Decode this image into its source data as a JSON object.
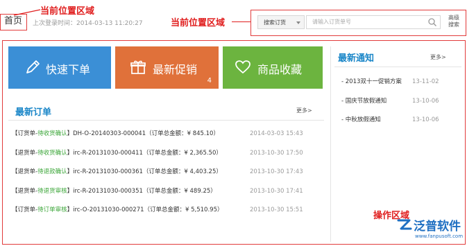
{
  "header": {
    "home_label": "首页",
    "last_login": "上次登录时间：2014-03-13 11:20:27",
    "annotation_left": "当前位置区域",
    "annotation_right": "当前位置区域",
    "search": {
      "category_selected": "搜索订货",
      "placeholder": "请输入订货单号"
    },
    "advanced_search_label": "高级搜索"
  },
  "tiles": [
    {
      "label": "快速下单",
      "icon": "pencil-icon",
      "color": "#3b8fd6"
    },
    {
      "label": "最新促销",
      "icon": "gift-icon",
      "badge": "4",
      "color": "#e0713a"
    },
    {
      "label": "商品收藏",
      "icon": "heart-icon",
      "color": "#6cb43f"
    }
  ],
  "orders": {
    "title": "最新订单",
    "more": "更多>",
    "rows": [
      {
        "type": "【订货单-",
        "status": "待收货确认",
        "rest": "】DH-O-20140303-000041（订单总金额：¥ 845.10）",
        "time": "2014-03-03 15:43"
      },
      {
        "type": "【退货单-",
        "status": "待收货确认",
        "rest": "】irc-R-20131030-000411（订单总金额：¥ 2,365.50）",
        "time": "2013-10-30 17:50"
      },
      {
        "type": "【退货单-",
        "status": "待退款确认",
        "rest": "】irc-R-20131030-000361（订单总金额：¥ 4,403.25）",
        "time": "2013-10-30 17:43"
      },
      {
        "type": "【退货单-",
        "status": "待退货审核",
        "rest": "】irc-R-20131030-000351（订单总金额：¥ 489.25）",
        "time": "2013-10-30 17:41"
      },
      {
        "type": "【订货单-",
        "status": "待订单审核",
        "rest": "】irc-O-20131030-000271（订单总金额：¥ 5,510.95）",
        "time": "2013-10-30 15:51"
      }
    ]
  },
  "notices": {
    "title": "最新通知",
    "more": "更多>",
    "items": [
      {
        "text": "- 2013双十一促销方案",
        "date": "13-11-02"
      },
      {
        "text": "- 国庆节放假通知",
        "date": "13-10-06"
      },
      {
        "text": "- 中秋放假通知",
        "date": "13-10-06"
      }
    ]
  },
  "annotations": {
    "operation_area": "操作区域"
  },
  "brand": {
    "name": "泛普软件",
    "url": "www.fanpusoft.com"
  },
  "colors": {
    "annotation_red": "#e01e1e",
    "panel_title_blue": "#1a86c8",
    "status_green": "#3aa537"
  }
}
